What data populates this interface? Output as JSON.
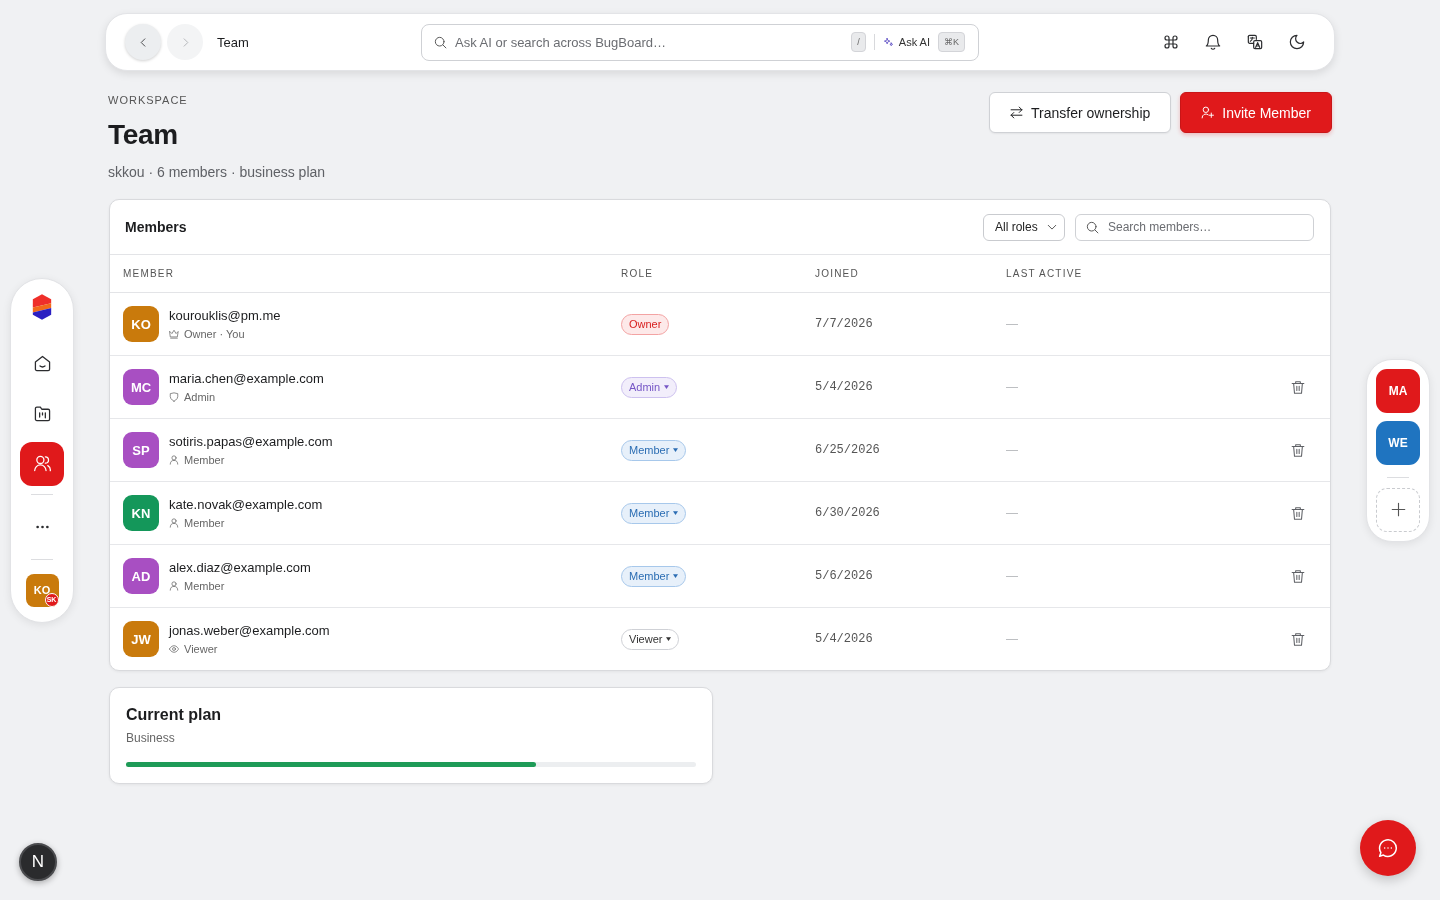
{
  "topbar": {
    "nav": [
      {
        "kind": "back",
        "disabled": false
      },
      {
        "kind": "forward",
        "disabled": true
      }
    ],
    "title": "Team",
    "search": {
      "placeholder": "Ask AI or search across BugBoard…",
      "shortcut": "/",
      "ai_label": "Ask AI",
      "ai_shortcut": "⌘K"
    }
  },
  "sidebar": {
    "items": [
      {
        "kind": "home",
        "selected": false
      },
      {
        "kind": "board",
        "selected": false
      },
      {
        "kind": "team",
        "selected": true
      }
    ],
    "user": {
      "initials": "KO",
      "color": "#c97a0c",
      "badge": "SK"
    }
  },
  "page": {
    "eyebrow": "WORKSPACE",
    "title": "Team",
    "subtitle": "skkou · 6 members · business plan",
    "actions": [
      {
        "kind": "transfer",
        "label": "Transfer ownership"
      },
      {
        "kind": "invite",
        "label": "Invite Member"
      }
    ]
  },
  "members": {
    "title": "Members",
    "role_filter": "All roles",
    "search_placeholder": "Search members…",
    "columns": [
      "MEMBER",
      "ROLE",
      "JOINED",
      "LAST ACTIVE"
    ],
    "rows": [
      {
        "initials": "KO",
        "color": "#c97a0c",
        "email": "kourouklis@pm.me",
        "role_note": "Owner · You",
        "role": {
          "label": "Owner",
          "kind": "owner",
          "menu": false
        },
        "joined": "7/7/2026",
        "last_active": "—",
        "removable": false
      },
      {
        "initials": "MC",
        "color": "#a84fc2",
        "email": "maria.chen@example.com",
        "role_note": "Admin",
        "role": {
          "label": "Admin",
          "kind": "admin",
          "menu": true
        },
        "joined": "5/4/2026",
        "last_active": "—",
        "removable": true
      },
      {
        "initials": "SP",
        "color": "#a84fc2",
        "email": "sotiris.papas@example.com",
        "role_note": "Member",
        "role": {
          "label": "Member",
          "kind": "member",
          "menu": true
        },
        "joined": "6/25/2026",
        "last_active": "—",
        "removable": true
      },
      {
        "initials": "KN",
        "color": "#14975a",
        "email": "kate.novak@example.com",
        "role_note": "Member",
        "role": {
          "label": "Member",
          "kind": "member",
          "menu": true
        },
        "joined": "6/30/2026",
        "last_active": "—",
        "removable": true
      },
      {
        "initials": "AD",
        "color": "#a84fc2",
        "email": "alex.diaz@example.com",
        "role_note": "Member",
        "role": {
          "label": "Member",
          "kind": "member",
          "menu": true
        },
        "joined": "5/6/2026",
        "last_active": "—",
        "removable": true
      },
      {
        "initials": "JW",
        "color": "#c97a0c",
        "email": "jonas.weber@example.com",
        "role_note": "Viewer",
        "role": {
          "label": "Viewer",
          "kind": "viewer",
          "menu": true
        },
        "joined": "5/4/2026",
        "last_active": "—",
        "removable": true
      }
    ]
  },
  "plan": {
    "title": "Current plan",
    "name": "Business",
    "level": 0.72
  },
  "workspaces": [
    {
      "initials": "MA",
      "color": "#e0191b"
    },
    {
      "initials": "WE",
      "color": "#1f74c0"
    }
  ],
  "dev_badge": "N"
}
